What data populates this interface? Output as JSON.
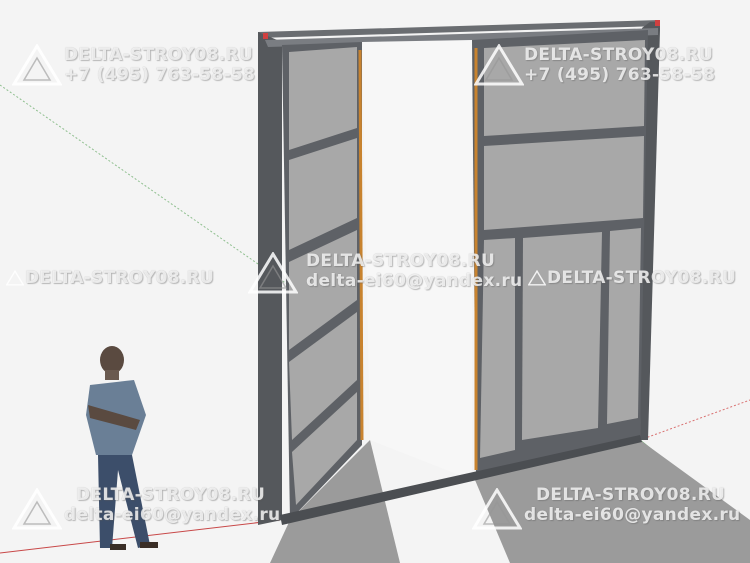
{
  "watermarks": {
    "site": "DELTA-STROY08.RU",
    "phone": "+7 (495) 763-58-58",
    "email": "delta-ei60@yandex.ru"
  },
  "colors": {
    "background": "#f4f4f4",
    "frame": "#5d6064",
    "glass": "#a9a9a9",
    "hinge_bar": "#c8832f",
    "shadow": "#9f9f9f"
  },
  "icons": [
    "delta-logo-icon"
  ]
}
